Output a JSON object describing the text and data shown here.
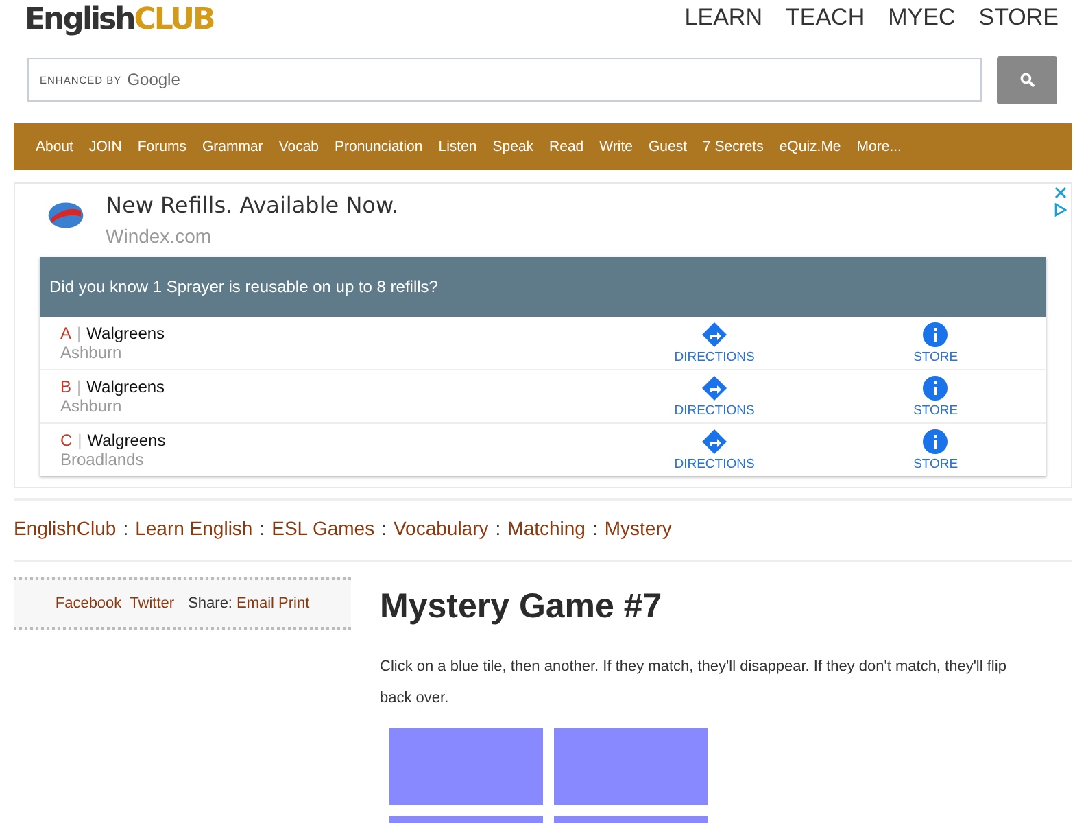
{
  "logo": {
    "first": "English",
    "second": "CLUB"
  },
  "top_nav": [
    "LEARN",
    "TEACH",
    "MYEC",
    "STORE"
  ],
  "search": {
    "placeholder_prefix": "ENHANCED BY",
    "placeholder_brand": "Google"
  },
  "menu": [
    "About",
    "JOIN",
    "Forums",
    "Grammar",
    "Vocab",
    "Pronunciation",
    "Listen",
    "Speak",
    "Read",
    "Write",
    "Guest",
    "7 Secrets",
    "eQuiz.Me",
    "More..."
  ],
  "ad": {
    "headline": "New Refills. Available Now.",
    "domain": "Windex.com",
    "banner": "Did you know 1 Sprayer is reusable on up to 8 refills?",
    "stores": [
      {
        "letter": "A",
        "separator": "|",
        "name": "Walgreens",
        "city": "Ashburn",
        "directions": "DIRECTIONS",
        "store": "STORE"
      },
      {
        "letter": "B",
        "separator": "|",
        "name": "Walgreens",
        "city": "Ashburn",
        "directions": "DIRECTIONS",
        "store": "STORE"
      },
      {
        "letter": "C",
        "separator": "|",
        "name": "Walgreens",
        "city": "Broadlands",
        "directions": "DIRECTIONS",
        "store": "STORE"
      }
    ]
  },
  "breadcrumb": [
    {
      "text": "EnglishClub"
    },
    {
      "separator": ":",
      "text": "Learn English"
    },
    {
      "separator": ":",
      "text": "ESL Games"
    },
    {
      "separator": ":",
      "text": "Vocabulary"
    },
    {
      "separator": ":",
      "text": "Matching"
    },
    {
      "separator": ":",
      "text": "Mystery"
    }
  ],
  "share": {
    "links": [
      "Facebook",
      "Twitter"
    ],
    "label": "Share:",
    "actions": [
      "Email",
      "Print"
    ]
  },
  "title": "Mystery Game #7",
  "instructions": "Click on a blue tile, then another. If they match, they'll disappear. If they don't match, they'll flip back over.",
  "tiles": [
    {
      "flipped": false
    },
    {
      "flipped": false
    },
    {
      "flipped": false
    },
    {
      "flipped": false
    }
  ]
}
